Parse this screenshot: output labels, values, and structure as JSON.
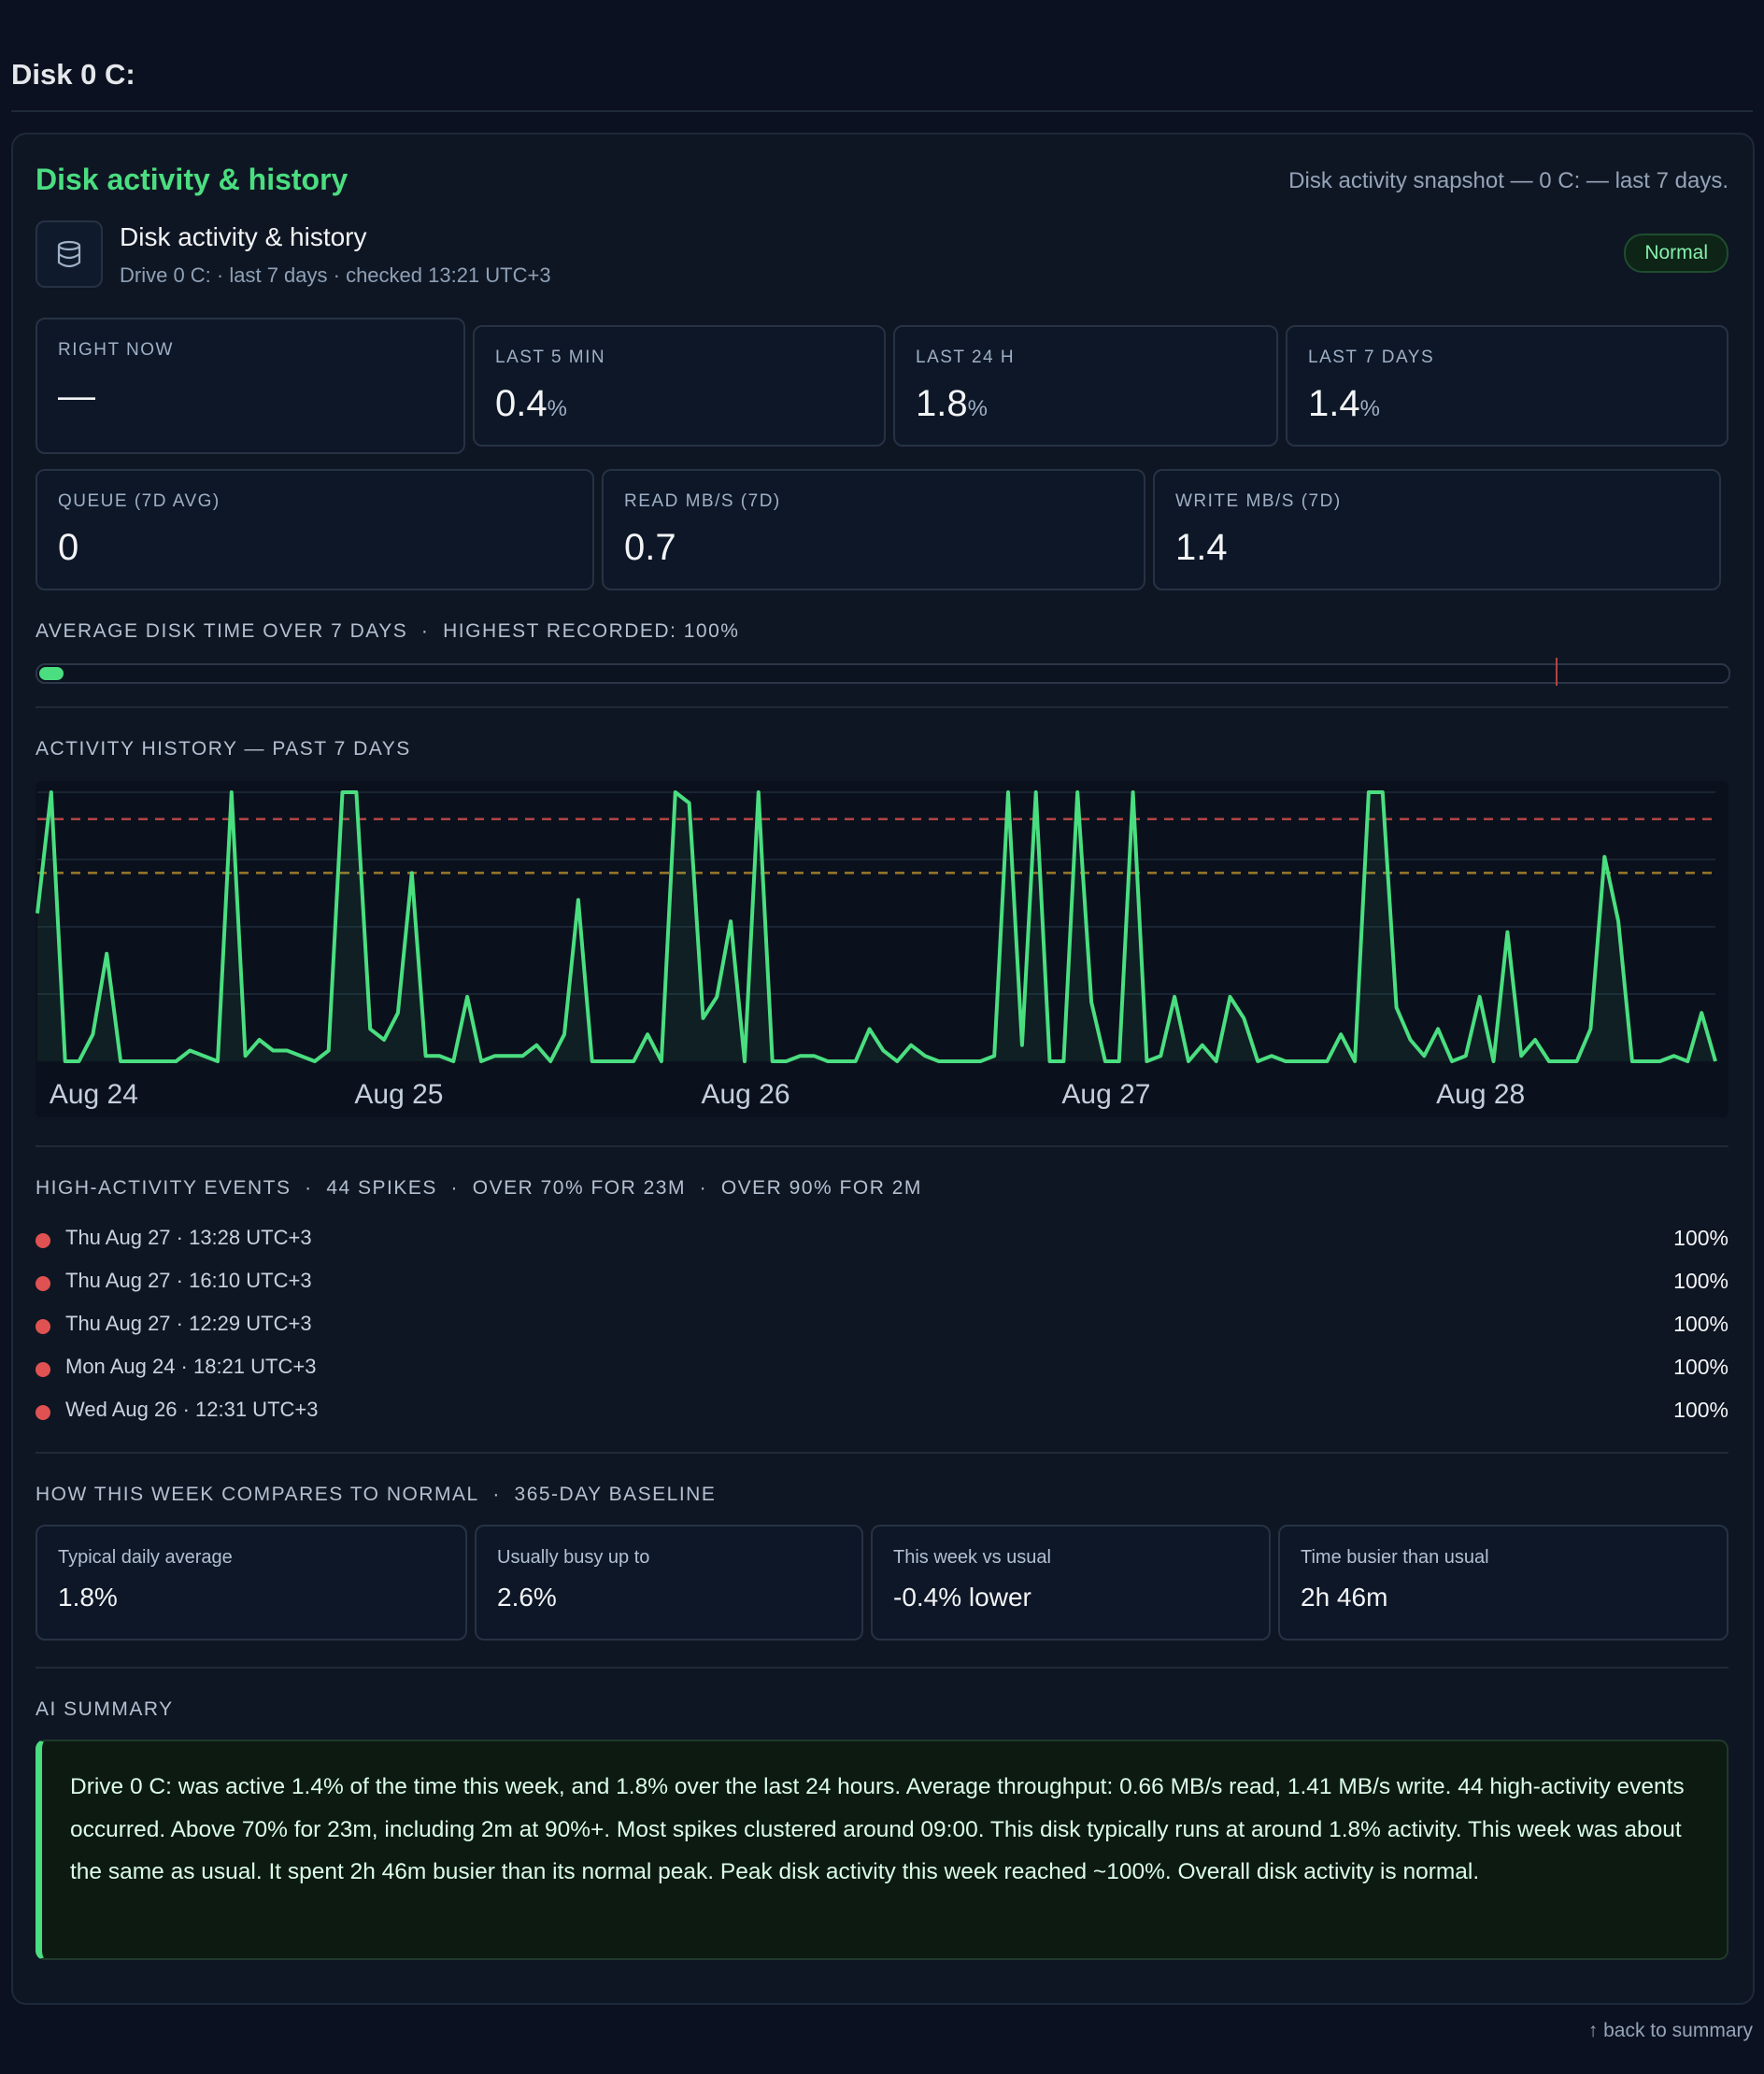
{
  "page": {
    "title": "Disk 0 C:",
    "back_link": "↑ back to summary"
  },
  "panel": {
    "title": "Disk activity & history",
    "snapshot": "Disk activity snapshot — 0 C: — last 7 days.",
    "header": {
      "icon": "disk-icon",
      "name": "Disk activity & history",
      "subtitle": "Drive 0 C: · last 7 days · checked 13:21 UTC+3",
      "status": "Normal"
    },
    "stats": [
      {
        "label": "RIGHT NOW",
        "value": "—",
        "unit": ""
      },
      {
        "label": "LAST 5 MIN",
        "value": "0.4",
        "unit": "%"
      },
      {
        "label": "LAST 24 H",
        "value": "1.8",
        "unit": "%"
      },
      {
        "label": "LAST 7 DAYS",
        "value": "1.4",
        "unit": "%"
      }
    ],
    "stats2": [
      {
        "label": "QUEUE (7D AVG)",
        "value": "0"
      },
      {
        "label": "READ MB/S (7D)",
        "value": "0.7"
      },
      {
        "label": "WRITE MB/S (7D)",
        "value": "1.4"
      }
    ],
    "average": {
      "caption": "AVERAGE DISK TIME OVER 7 DAYS",
      "highest": "HIGHEST RECORDED: 100%",
      "value_pct": 1.4,
      "marker_pct": 90
    },
    "history": {
      "caption": "ACTIVITY HISTORY — PAST 7 DAYS"
    },
    "events": {
      "caption": "HIGH-ACTIVITY EVENTS",
      "spikes": "44 SPIKES",
      "over70": "OVER 70% FOR 23M",
      "over90": "OVER 90% FOR 2M",
      "items": [
        {
          "when": "Thu Aug 27 · 13:28 UTC+3",
          "value": "100%"
        },
        {
          "when": "Thu Aug 27 · 16:10 UTC+3",
          "value": "100%"
        },
        {
          "when": "Thu Aug 27 · 12:29 UTC+3",
          "value": "100%"
        },
        {
          "when": "Mon Aug 24 · 18:21 UTC+3",
          "value": "100%"
        },
        {
          "when": "Wed Aug 26 · 12:31 UTC+3",
          "value": "100%"
        }
      ]
    },
    "compare": {
      "caption": "HOW THIS WEEK COMPARES TO NORMAL",
      "baseline": "365-DAY BASELINE",
      "items": [
        {
          "label": "Typical daily average",
          "value": "1.8%"
        },
        {
          "label": "Usually busy up to",
          "value": "2.6%"
        },
        {
          "label": "This week vs usual",
          "value": "-0.4% lower"
        },
        {
          "label": "Time busier than usual",
          "value": "2h 46m"
        }
      ]
    },
    "summary": {
      "caption": "AI SUMMARY",
      "text": "Drive 0 C: was active 1.4% of the time this week, and 1.8% over the last 24 hours. Average throughput: 0.66 MB/s read, 1.41 MB/s write. 44 high-activity events occurred. Above 70% for 23m, including 2m at 90%+. Most spikes clustered around 09:00. This disk typically runs at around 1.8% activity. This week was about the same as usual. It spent 2h 46m busier than its normal peak. Peak disk activity this week reached ~100%. Overall disk activity is normal."
    }
  },
  "chart_data": {
    "type": "line",
    "title": "",
    "xlabel": "",
    "ylabel": "",
    "ylim": [
      0,
      100
    ],
    "y_unit": "%",
    "grid": true,
    "x_ticks": [
      {
        "label": "Aug 24",
        "index": 1
      },
      {
        "label": "Aug 25",
        "index": 23
      },
      {
        "label": "Aug 26",
        "index": 48
      },
      {
        "label": "Aug 27",
        "index": 74
      },
      {
        "label": "Aug 28",
        "index": 101
      }
    ],
    "thresholds": [
      {
        "value": 90,
        "color": "#b04444"
      },
      {
        "value": 70,
        "color": "#9a7a2a"
      }
    ],
    "series": [
      {
        "color": "#4ade80",
        "values": [
          55,
          100,
          0,
          0,
          10,
          40,
          0,
          0,
          0,
          0,
          0,
          4,
          2,
          0,
          100,
          2,
          8,
          4,
          4,
          2,
          0,
          4,
          100,
          100,
          12,
          8,
          18,
          70,
          2,
          2,
          0,
          24,
          0,
          2,
          2,
          2,
          6,
          0,
          10,
          60,
          0,
          0,
          0,
          0,
          10,
          0,
          100,
          96,
          16,
          24,
          52,
          0,
          100,
          0,
          0,
          2,
          2,
          0,
          0,
          0,
          12,
          4,
          0,
          6,
          2,
          0,
          0,
          0,
          0,
          2,
          100,
          6,
          100,
          0,
          0,
          100,
          22,
          0,
          0,
          100,
          0,
          2,
          24,
          0,
          6,
          0,
          24,
          16,
          0,
          2,
          0,
          0,
          0,
          0,
          10,
          0,
          100,
          100,
          20,
          8,
          2,
          12,
          0,
          2,
          24,
          0,
          48,
          2,
          8,
          0,
          0,
          0,
          12,
          76,
          52,
          0,
          0,
          0,
          2,
          0,
          18,
          0
        ]
      }
    ]
  }
}
